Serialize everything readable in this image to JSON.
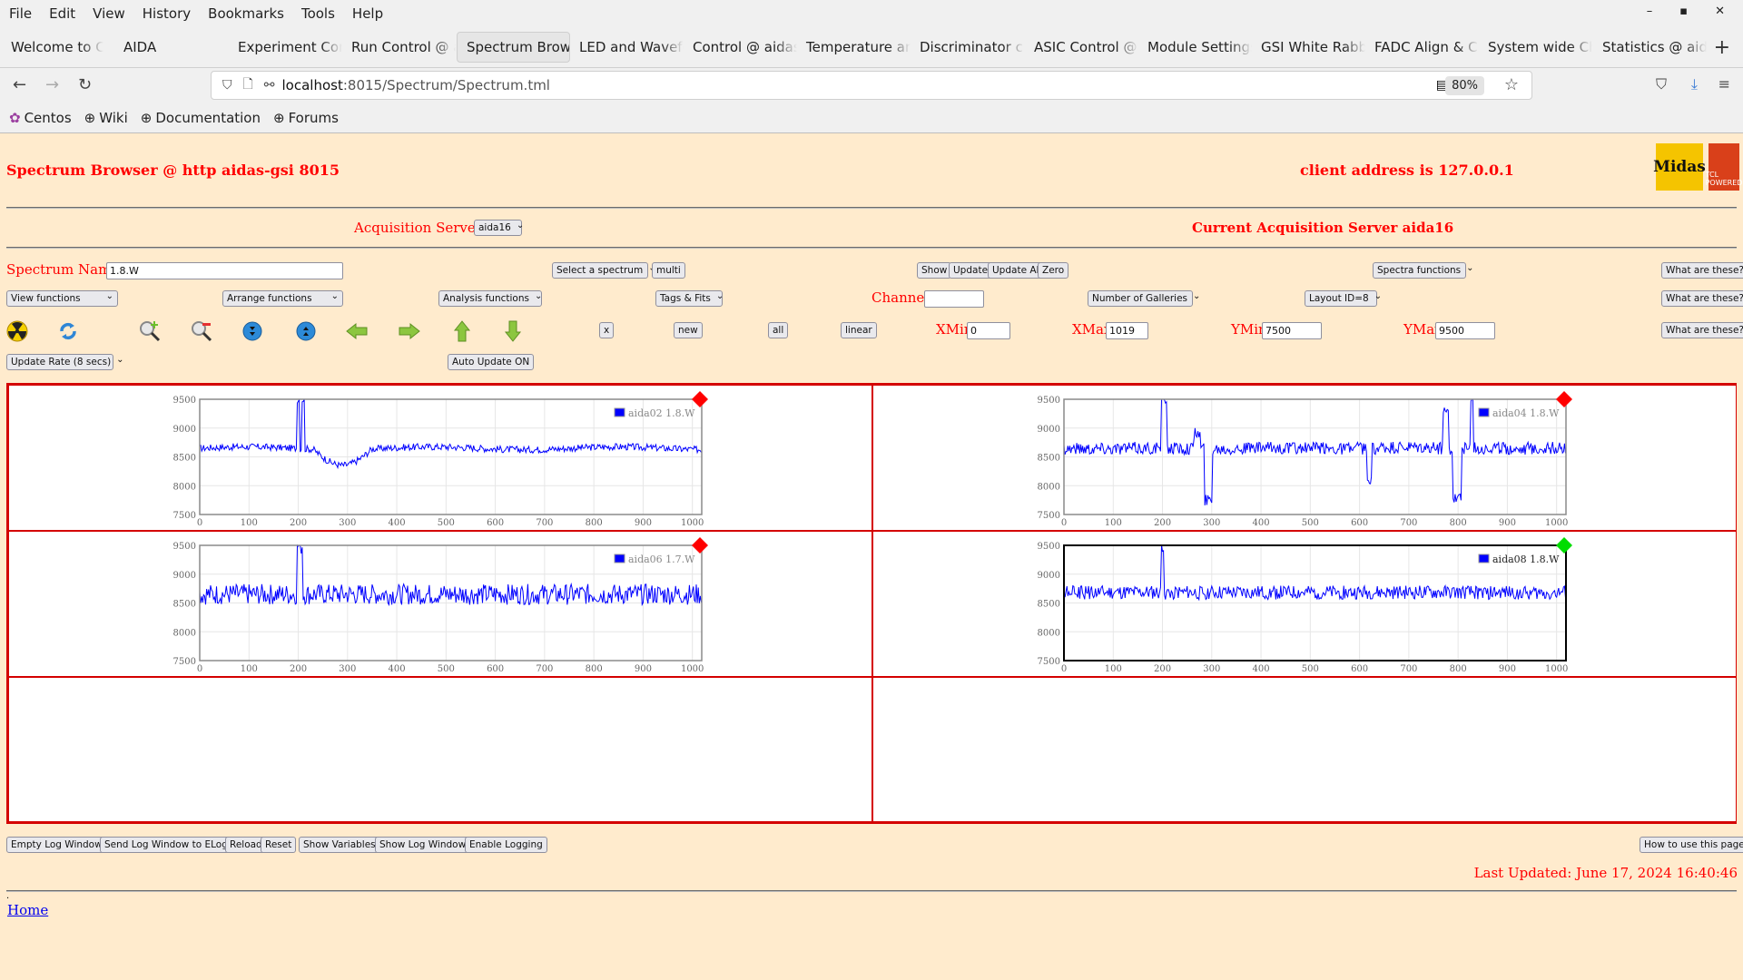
{
  "browser": {
    "menu": [
      "File",
      "Edit",
      "View",
      "History",
      "Bookmarks",
      "Tools",
      "Help"
    ],
    "window_controls": [
      "–",
      "▪",
      "✕"
    ],
    "tabs": [
      {
        "label": "Welcome to Cen",
        "active": false
      },
      {
        "label": "AIDA",
        "active": false
      },
      {
        "label": "Experiment Cont",
        "active": false
      },
      {
        "label": "Run Control @ a",
        "active": false
      },
      {
        "label": "Spectrum Brow",
        "active": true
      },
      {
        "label": "LED and Wavefo",
        "active": false
      },
      {
        "label": "Control @ aidas",
        "active": false
      },
      {
        "label": "Temperature and",
        "active": false
      },
      {
        "label": "Discriminator co",
        "active": false
      },
      {
        "label": "ASIC Control @",
        "active": false
      },
      {
        "label": "Module Settings",
        "active": false
      },
      {
        "label": "GSI White Rabbi",
        "active": false
      },
      {
        "label": "FADC Align & C",
        "active": false
      },
      {
        "label": "System wide Ch",
        "active": false
      },
      {
        "label": "Statistics @ aid",
        "active": false
      }
    ],
    "url_host": "localhost",
    "url_path": ":8015/Spectrum/Spectrum.tml",
    "zoom": "80%",
    "bookmarks": [
      "Centos",
      "Wiki",
      "Documentation",
      "Forums"
    ]
  },
  "header": {
    "title": "Spectrum Browser @ http aidas-gsi 8015",
    "client_address": "client address is 127.0.0.1",
    "logo_midas": "Midas",
    "logo_tcl": "TCL POWERED"
  },
  "acquisition": {
    "label": "Acquisition Servers",
    "selected_server": "aida16",
    "current": "Current Acquisition Server aida16"
  },
  "controls": {
    "spectrum_name_label": "Spectrum Name:",
    "spectrum_name_value": "1.8.W",
    "select_spectrum": "Select a spectrum",
    "multi": "multi",
    "show": "Show",
    "update": "Update",
    "update_all": "Update All",
    "zero": "Zero",
    "spectra_functions": "Spectra functions",
    "what_are_these": "What are these?",
    "view_functions": "View functions",
    "arrange_functions": "Arrange functions",
    "analysis_functions": "Analysis functions",
    "tags_fits": "Tags & Fits",
    "channel_label": "Channel:",
    "channel_value": "",
    "number_of_galleries": "Number of Galleries",
    "layout": "Layout ID=8",
    "x_button": "x",
    "new_button": "new",
    "all_button": "all",
    "linear_button": "linear",
    "xmin_label": "XMin",
    "xmin_value": "0",
    "xmax_label": "XMax",
    "xmax_value": "1019",
    "ymin_label": "YMin",
    "ymin_value": "7500",
    "ymax_label": "YMax",
    "ymax_value": "9500",
    "update_rate": "Update Rate (8 secs)",
    "auto_update": "Auto Update ON"
  },
  "toolbar_icons": [
    "radiation-icon",
    "refresh-icon",
    "zoom-in-icon",
    "zoom-out-icon",
    "expand-vertical-icon",
    "compress-vertical-icon",
    "arrow-left-icon",
    "arrow-right-icon",
    "arrow-up-icon",
    "arrow-down-icon"
  ],
  "colors": {
    "page_bg": "#ffebcd",
    "accent_red": "#ff0000",
    "grid_border": "#d40000",
    "series_blue": "#0000ff",
    "marker_red": "#ff0000",
    "marker_green": "#00dd00"
  },
  "chart_data": [
    {
      "type": "line",
      "legend": "aida02 1.8.W",
      "marker": "red",
      "selected": false,
      "xlim": [
        0,
        1019
      ],
      "ylim": [
        7500,
        9500
      ],
      "xticks": [
        0,
        100,
        200,
        300,
        400,
        500,
        600,
        700,
        800,
        900,
        1000
      ],
      "yticks": [
        7500,
        8000,
        8500,
        9000,
        9500
      ],
      "baseline": 8650,
      "noise": 60,
      "features": [
        {
          "x": 200,
          "y": 9500,
          "width": 3
        },
        {
          "x": 210,
          "y": 9500,
          "width": 3
        },
        {
          "x": 290,
          "y": 8380,
          "width": 60
        }
      ]
    },
    {
      "type": "line",
      "legend": "aida04 1.8.W",
      "marker": "red",
      "selected": false,
      "xlim": [
        0,
        1019
      ],
      "ylim": [
        7500,
        9500
      ],
      "xticks": [
        0,
        100,
        200,
        300,
        400,
        500,
        600,
        700,
        800,
        900,
        1000
      ],
      "yticks": [
        7500,
        8000,
        8500,
        9000,
        9500
      ],
      "baseline": 8650,
      "noise": 110,
      "features": [
        {
          "x": 200,
          "y": 9500,
          "width": 3
        },
        {
          "x": 205,
          "y": 9500,
          "width": 3
        },
        {
          "x": 293,
          "y": 7750,
          "width": 8
        },
        {
          "x": 270,
          "y": 8900,
          "width": 6
        },
        {
          "x": 620,
          "y": 8050,
          "width": 5
        },
        {
          "x": 775,
          "y": 9300,
          "width": 5
        },
        {
          "x": 798,
          "y": 7800,
          "width": 8
        },
        {
          "x": 828,
          "y": 9500,
          "width": 3
        }
      ]
    },
    {
      "type": "line",
      "legend": "aida06 1.7.W",
      "marker": "red",
      "selected": false,
      "xlim": [
        0,
        1019
      ],
      "ylim": [
        7500,
        9500
      ],
      "xticks": [
        0,
        100,
        200,
        300,
        400,
        500,
        600,
        700,
        800,
        900,
        1000
      ],
      "yticks": [
        7500,
        8000,
        8500,
        9000,
        9500
      ],
      "baseline": 8650,
      "noise": 180,
      "features": [
        {
          "x": 200,
          "y": 9500,
          "width": 3
        },
        {
          "x": 205,
          "y": 9500,
          "width": 3
        }
      ]
    },
    {
      "type": "line",
      "legend": "aida08 1.8.W",
      "marker": "green",
      "selected": true,
      "xlim": [
        0,
        1019
      ],
      "ylim": [
        7500,
        9500
      ],
      "xticks": [
        0,
        100,
        200,
        300,
        400,
        500,
        600,
        700,
        800,
        900,
        1000
      ],
      "yticks": [
        7500,
        8000,
        8500,
        9000,
        9500
      ],
      "baseline": 8680,
      "noise": 120,
      "features": [
        {
          "x": 200,
          "y": 9500,
          "width": 2
        }
      ]
    }
  ],
  "footer": {
    "buttons": [
      "Empty Log Window",
      "Send Log Window to ELog",
      "Reload",
      "Reset",
      "Show Variables",
      "Show Log Window",
      "Enable Logging"
    ],
    "how_to": "How to use this page",
    "last_updated": "Last Updated: June 17, 2024 16:40:46",
    "home": "Home",
    "dot": "."
  }
}
